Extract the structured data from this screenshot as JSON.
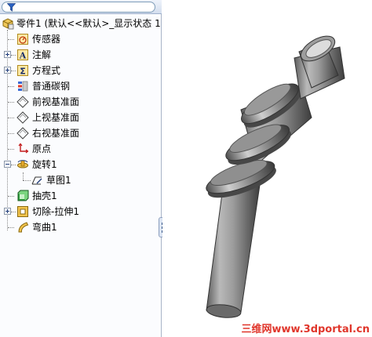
{
  "tree": {
    "part_name": "零件1  (默认<<默认>_显示状态 1",
    "items": [
      {
        "label": "传感器"
      },
      {
        "label": "注解"
      },
      {
        "label": "方程式"
      },
      {
        "label": "普通碳钢"
      },
      {
        "label": "前视基准面"
      },
      {
        "label": "上视基准面"
      },
      {
        "label": "右视基准面"
      },
      {
        "label": "原点"
      },
      {
        "label": "旋转1"
      },
      {
        "label": "草图1"
      },
      {
        "label": "抽壳1"
      },
      {
        "label": "切除-拉伸1"
      },
      {
        "label": "弯曲1"
      }
    ]
  },
  "watermark": "三维网www.3dportal.cn",
  "colors": {
    "model_body": "#9a9a9a",
    "model_shadow": "#4a4a4a",
    "selection_blue": "#1f3c7a",
    "watermark_red": "#e0362b"
  }
}
